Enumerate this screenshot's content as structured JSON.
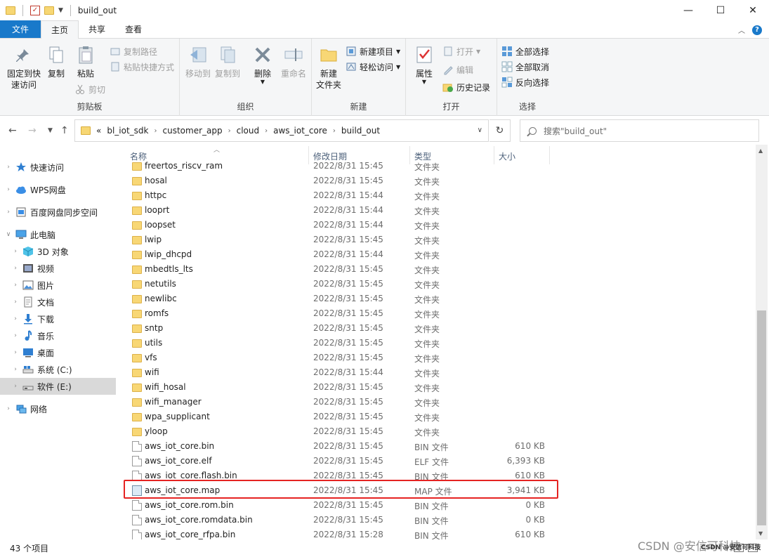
{
  "window": {
    "title": "build_out",
    "controls": {
      "minimize": "—",
      "maximize": "☐",
      "close": "✕"
    }
  },
  "ribbon_tabs": [
    "文件",
    "主页",
    "共享",
    "查看"
  ],
  "ribbon": {
    "clipboard": {
      "label": "剪贴板",
      "pin_line1": "固定到快",
      "pin_line2": "速访问",
      "copy": "复制",
      "paste": "粘贴",
      "copy_path": "复制路径",
      "paste_shortcut": "粘贴快捷方式",
      "cut": "剪切"
    },
    "organize": {
      "label": "组织",
      "move_to": "移动到",
      "copy_to": "复制到",
      "delete": "删除",
      "rename": "重命名"
    },
    "new": {
      "label": "新建",
      "new_folder_line1": "新建",
      "new_folder_line2": "文件夹",
      "new_item": "新建项目",
      "easy_access": "轻松访问"
    },
    "open": {
      "label": "打开",
      "properties": "属性",
      "open": "打开",
      "edit": "编辑",
      "history": "历史记录"
    },
    "select": {
      "label": "选择",
      "select_all": "全部选择",
      "select_none": "全部取消",
      "invert": "反向选择"
    }
  },
  "address": {
    "crumbs": [
      "«",
      "bl_iot_sdk",
      "customer_app",
      "cloud",
      "aws_iot_core",
      "build_out"
    ],
    "search_placeholder": "搜索\"build_out\""
  },
  "navpane": [
    {
      "label": "快速访问",
      "icon": "star-icon",
      "level": 0
    },
    {
      "label": "WPS网盘",
      "icon": "cloud-icon",
      "level": 0
    },
    {
      "label": "百度网盘同步空间",
      "icon": "baidu-sync-icon",
      "level": 0
    },
    {
      "label": "此电脑",
      "icon": "computer-icon",
      "level": 0,
      "expanded": true
    },
    {
      "label": "3D 对象",
      "icon": "cube-icon",
      "level": 1
    },
    {
      "label": "视频",
      "icon": "video-icon",
      "level": 1
    },
    {
      "label": "图片",
      "icon": "picture-icon",
      "level": 1
    },
    {
      "label": "文档",
      "icon": "document-icon",
      "level": 1
    },
    {
      "label": "下载",
      "icon": "download-icon",
      "level": 1
    },
    {
      "label": "音乐",
      "icon": "music-icon",
      "level": 1
    },
    {
      "label": "桌面",
      "icon": "desktop-icon",
      "level": 1
    },
    {
      "label": "系统 (C:)",
      "icon": "drive-c-icon",
      "level": 1
    },
    {
      "label": "软件 (E:)",
      "icon": "drive-e-icon",
      "level": 1,
      "selected": true
    },
    {
      "label": "网络",
      "icon": "network-icon",
      "level": 0
    }
  ],
  "columns": {
    "name": "名称",
    "date": "修改日期",
    "type": "类型",
    "size": "大小"
  },
  "files": [
    {
      "name": "freertos_riscv_ram",
      "date": "2022/8/31 15:45",
      "type": "文件夹",
      "size": "",
      "kind": "folder"
    },
    {
      "name": "hosal",
      "date": "2022/8/31 15:45",
      "type": "文件夹",
      "size": "",
      "kind": "folder"
    },
    {
      "name": "httpc",
      "date": "2022/8/31 15:44",
      "type": "文件夹",
      "size": "",
      "kind": "folder"
    },
    {
      "name": "looprt",
      "date": "2022/8/31 15:44",
      "type": "文件夹",
      "size": "",
      "kind": "folder"
    },
    {
      "name": "loopset",
      "date": "2022/8/31 15:44",
      "type": "文件夹",
      "size": "",
      "kind": "folder"
    },
    {
      "name": "lwip",
      "date": "2022/8/31 15:45",
      "type": "文件夹",
      "size": "",
      "kind": "folder"
    },
    {
      "name": "lwip_dhcpd",
      "date": "2022/8/31 15:44",
      "type": "文件夹",
      "size": "",
      "kind": "folder"
    },
    {
      "name": "mbedtls_lts",
      "date": "2022/8/31 15:45",
      "type": "文件夹",
      "size": "",
      "kind": "folder"
    },
    {
      "name": "netutils",
      "date": "2022/8/31 15:45",
      "type": "文件夹",
      "size": "",
      "kind": "folder"
    },
    {
      "name": "newlibc",
      "date": "2022/8/31 15:45",
      "type": "文件夹",
      "size": "",
      "kind": "folder"
    },
    {
      "name": "romfs",
      "date": "2022/8/31 15:45",
      "type": "文件夹",
      "size": "",
      "kind": "folder"
    },
    {
      "name": "sntp",
      "date": "2022/8/31 15:45",
      "type": "文件夹",
      "size": "",
      "kind": "folder"
    },
    {
      "name": "utils",
      "date": "2022/8/31 15:45",
      "type": "文件夹",
      "size": "",
      "kind": "folder"
    },
    {
      "name": "vfs",
      "date": "2022/8/31 15:45",
      "type": "文件夹",
      "size": "",
      "kind": "folder"
    },
    {
      "name": "wifi",
      "date": "2022/8/31 15:44",
      "type": "文件夹",
      "size": "",
      "kind": "folder"
    },
    {
      "name": "wifi_hosal",
      "date": "2022/8/31 15:45",
      "type": "文件夹",
      "size": "",
      "kind": "folder"
    },
    {
      "name": "wifi_manager",
      "date": "2022/8/31 15:45",
      "type": "文件夹",
      "size": "",
      "kind": "folder"
    },
    {
      "name": "wpa_supplicant",
      "date": "2022/8/31 15:45",
      "type": "文件夹",
      "size": "",
      "kind": "folder"
    },
    {
      "name": "yloop",
      "date": "2022/8/31 15:45",
      "type": "文件夹",
      "size": "",
      "kind": "folder"
    },
    {
      "name": "aws_iot_core.bin",
      "date": "2022/8/31 15:45",
      "type": "BIN 文件",
      "size": "610 KB",
      "kind": "file"
    },
    {
      "name": "aws_iot_core.elf",
      "date": "2022/8/31 15:45",
      "type": "ELF 文件",
      "size": "6,393 KB",
      "kind": "file"
    },
    {
      "name": "aws_iot_core.flash.bin",
      "date": "2022/8/31 15:45",
      "type": "BIN 文件",
      "size": "610 KB",
      "kind": "file"
    },
    {
      "name": "aws_iot_core.map",
      "date": "2022/8/31 15:45",
      "type": "MAP 文件",
      "size": "3,941 KB",
      "kind": "map",
      "highlighted": true
    },
    {
      "name": "aws_iot_core.rom.bin",
      "date": "2022/8/31 15:45",
      "type": "BIN 文件",
      "size": "0 KB",
      "kind": "file"
    },
    {
      "name": "aws_iot_core.romdata.bin",
      "date": "2022/8/31 15:45",
      "type": "BIN 文件",
      "size": "0 KB",
      "kind": "file"
    },
    {
      "name": "aws_iot_core_rfpa.bin",
      "date": "2022/8/31 15:28",
      "type": "BIN 文件",
      "size": "610 KB",
      "kind": "file"
    }
  ],
  "status": {
    "item_count": "43 个项目"
  },
  "watermark": {
    "main": "CSDN @安信可科技",
    "small": "CSDN @安信可科技"
  },
  "colors": {
    "accent": "#1979ca",
    "highlight": "#e52322",
    "folder": "#f8d775"
  }
}
